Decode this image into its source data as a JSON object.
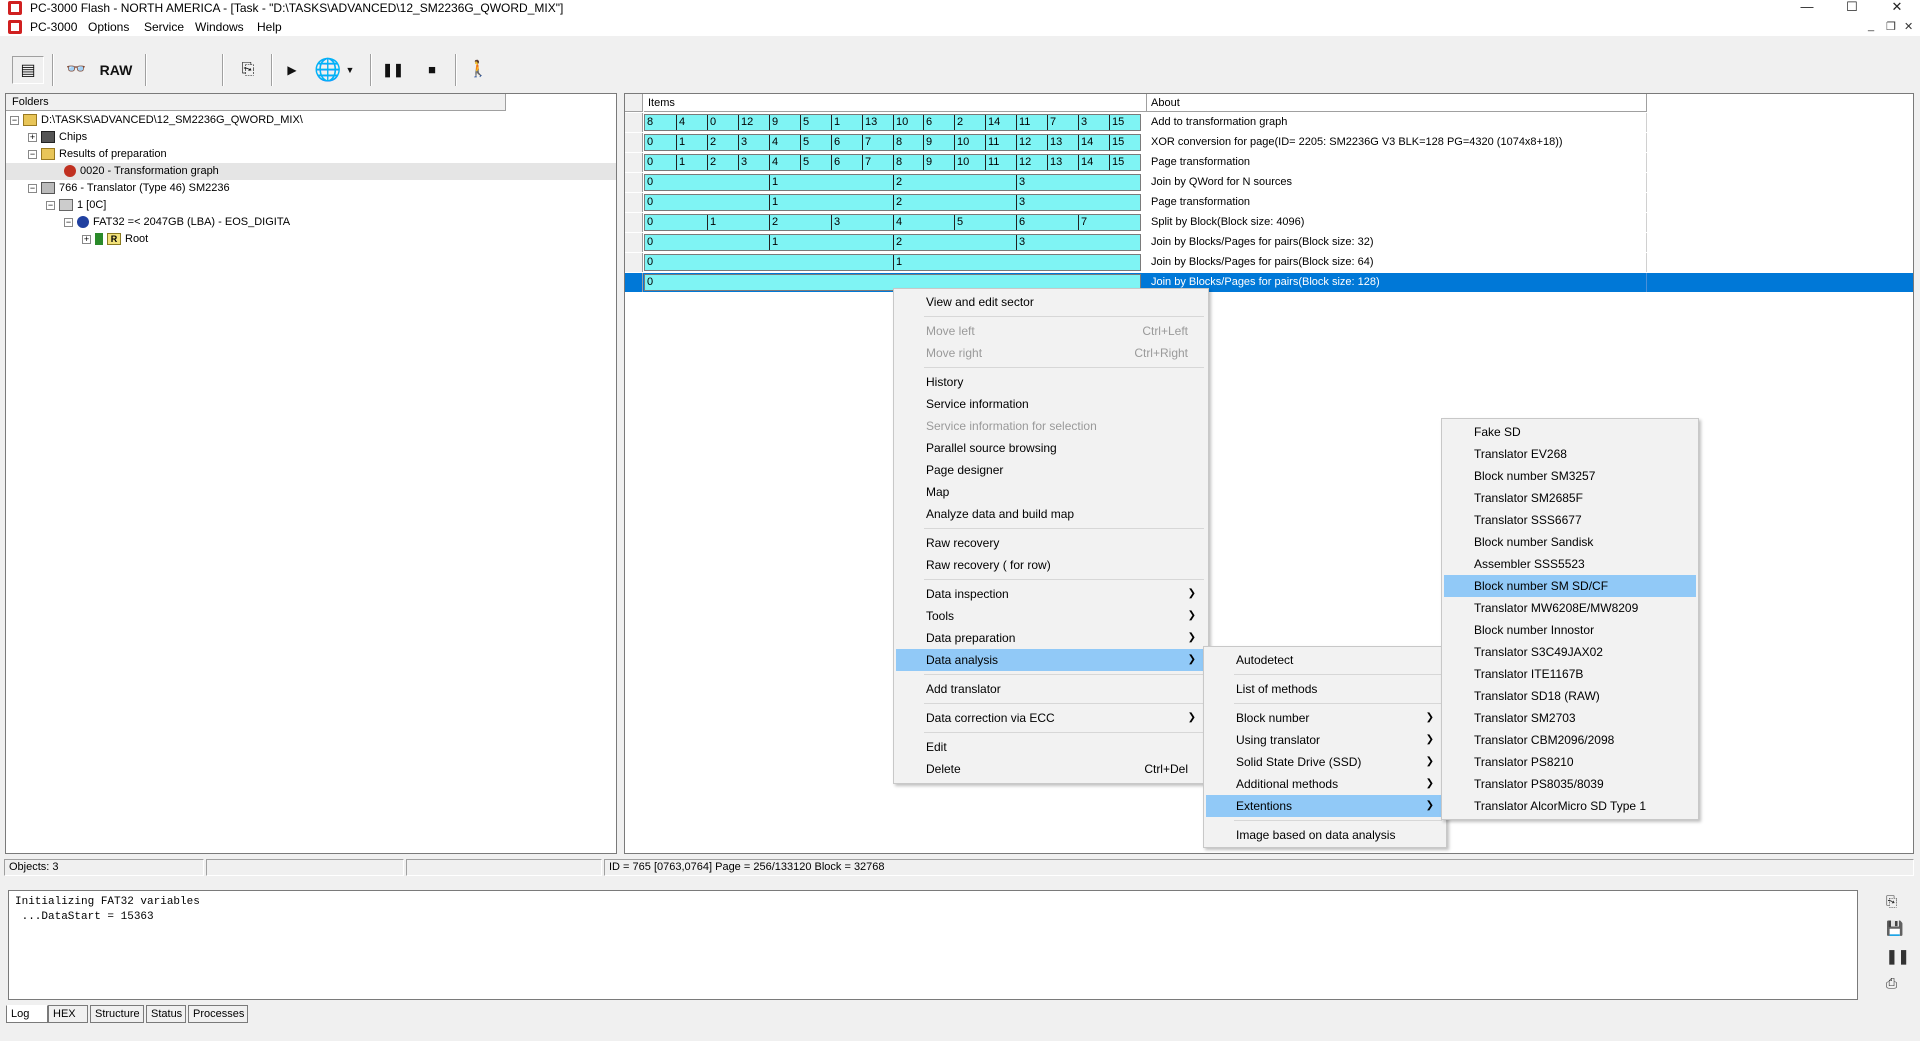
{
  "window": {
    "title": "PC-3000 Flash - NORTH AMERICA - [Task - \"D:\\TASKS\\ADVANCED\\12_SM2236G_QWORD_MIX\"]",
    "minimize": "—",
    "maximize": "☐",
    "close": "✕"
  },
  "menubar": {
    "app_label": "PC-3000",
    "items": [
      "Options",
      "Service",
      "Windows",
      "Help"
    ]
  },
  "toolbar": {
    "raw_label": "RAW"
  },
  "folders": {
    "header": "Folders",
    "items": [
      {
        "label": "D:\\TASKS\\ADVANCED\\12_SM2236G_QWORD_MIX\\",
        "expander": "−"
      },
      {
        "label": "Chips",
        "expander": "+"
      },
      {
        "label": "Results of preparation",
        "expander": "−"
      },
      {
        "label": "0020 - Transformation graph",
        "expander": ""
      },
      {
        "label": "766 - Translator  (Type 46) SM2236",
        "expander": "−"
      },
      {
        "label": "1 [0C]",
        "expander": "−"
      },
      {
        "label": "FAT32 =< 2047GB (LBA) - EOS_DIGITA",
        "expander": "−"
      },
      {
        "label": "Root",
        "expander": "+"
      }
    ]
  },
  "grid": {
    "col_items": "Items",
    "col_about": "About",
    "rows": [
      {
        "cells": [
          "8",
          "4",
          "0",
          "12",
          "9",
          "5",
          "1",
          "13",
          "10",
          "6",
          "2",
          "14",
          "11",
          "7",
          "3",
          "15"
        ],
        "about": "Add to transformation graph"
      },
      {
        "cells": [
          "0",
          "1",
          "2",
          "3",
          "4",
          "5",
          "6",
          "7",
          "8",
          "9",
          "10",
          "11",
          "12",
          "13",
          "14",
          "15"
        ],
        "about": "XOR conversion for page(ID= 2205: SM2236G V3 BLK=128 PG=4320 (1074x8+18))"
      },
      {
        "cells": [
          "0",
          "1",
          "2",
          "3",
          "4",
          "5",
          "6",
          "7",
          "8",
          "9",
          "10",
          "11",
          "12",
          "13",
          "14",
          "15"
        ],
        "about": "Page transformation"
      },
      {
        "cells": [
          "0",
          "1",
          "2",
          "3"
        ],
        "about": "Join by QWord for N sources"
      },
      {
        "cells": [
          "0",
          "1",
          "2",
          "3"
        ],
        "about": "Page transformation"
      },
      {
        "cells": [
          "0",
          "1",
          "2",
          "3",
          "4",
          "5",
          "6",
          "7"
        ],
        "about": "Split by Block(Block size: 4096)"
      },
      {
        "cells": [
          "0",
          "1",
          "2",
          "3"
        ],
        "about": "Join by Blocks/Pages for pairs(Block size: 32)"
      },
      {
        "cells": [
          "0",
          "1"
        ],
        "about": "Join by Blocks/Pages for pairs(Block size: 64)"
      },
      {
        "cells": [
          "0"
        ],
        "about": "Join by Blocks/Pages for pairs(Block size: 128)"
      }
    ]
  },
  "context_menu": {
    "items": [
      {
        "label": "View and edit sector",
        "shortcut": "",
        "disabled": false
      },
      {
        "label": "Move left",
        "shortcut": "Ctrl+Left",
        "disabled": true
      },
      {
        "label": "Move right",
        "shortcut": "Ctrl+Right",
        "disabled": true
      },
      {
        "label": "History",
        "shortcut": "",
        "disabled": false
      },
      {
        "label": "Service information",
        "shortcut": "",
        "disabled": false
      },
      {
        "label": "Service information for selection",
        "shortcut": "",
        "disabled": true
      },
      {
        "label": "Parallel source browsing",
        "shortcut": "",
        "disabled": false
      },
      {
        "label": "Page designer",
        "shortcut": "",
        "disabled": false
      },
      {
        "label": "Map",
        "shortcut": "",
        "disabled": false
      },
      {
        "label": "Analyze data and build map",
        "shortcut": "",
        "disabled": false
      },
      {
        "label": "Raw recovery",
        "shortcut": "",
        "disabled": false
      },
      {
        "label": "Raw recovery ( for row)",
        "shortcut": "",
        "disabled": false
      },
      {
        "label": "Data inspection",
        "shortcut": "",
        "disabled": false
      },
      {
        "label": "Tools",
        "shortcut": "",
        "disabled": false
      },
      {
        "label": "Data preparation",
        "shortcut": "",
        "disabled": false
      },
      {
        "label": "Data analysis",
        "shortcut": "",
        "disabled": false
      },
      {
        "label": "Add translator",
        "shortcut": "",
        "disabled": false
      },
      {
        "label": "Data correction via ECC",
        "shortcut": "",
        "disabled": false
      },
      {
        "label": "Edit",
        "shortcut": "",
        "disabled": false
      },
      {
        "label": "Delete",
        "shortcut": "Ctrl+Del",
        "disabled": false
      }
    ]
  },
  "analysis_menu": {
    "items": [
      "Autodetect",
      "List of methods",
      "Block number",
      "Using translator",
      "Solid State Drive (SSD)",
      "Additional methods",
      "Extentions",
      "Image based on data analysis"
    ]
  },
  "extensions_menu": {
    "items": [
      "Fake SD",
      "Translator EV268",
      "Block number SM3257",
      "Translator SM2685F",
      "Translator SSS6677",
      "Block number Sandisk",
      "Assembler SSS5523",
      "Block number SM SD/CF",
      "Translator MW6208E/MW8209",
      "Block number Innostor",
      "Translator S3C49JAX02",
      "Translator ITE1167B",
      "Translator SD18 (RAW)",
      "Translator SM2703",
      "Translator CBM2096/2098",
      "Translator PS8210",
      "Translator PS8035/8039",
      "Translator AlcorMicro SD Type 1"
    ]
  },
  "status": {
    "objects": "Objects: 3",
    "info": "ID = 765 [0763,0764] Page  = 256/133120 Block = 32768"
  },
  "log": {
    "lines": [
      "Initializing FAT32 variables",
      " ...DataStart = 15363"
    ],
    "tabs": [
      "Log",
      "HEX",
      "Structure",
      "Status",
      "Processes"
    ]
  },
  "colors": {
    "items_cell": "#7ff4f4",
    "selection": "#0078d7",
    "menu_highlight": "#91c9f7"
  }
}
